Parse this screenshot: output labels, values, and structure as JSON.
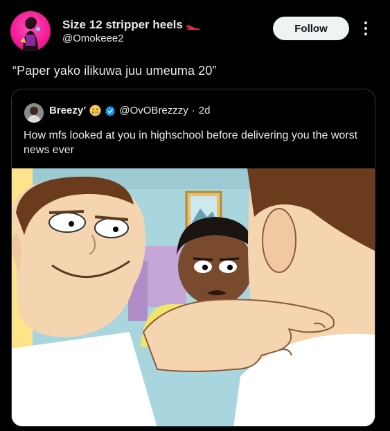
{
  "author": {
    "display_name": "Size 12 stripper heels",
    "name_emoji_icon": "high-heel-icon",
    "handle": "@Omokeee2"
  },
  "follow_button": {
    "label": "Follow"
  },
  "more_menu": {
    "icon": "more-vertical-icon"
  },
  "tweet": {
    "text": "“Paper yako ilikuwa juu umeuma 20”"
  },
  "quoted_tweet": {
    "display_name": "Breezy’",
    "name_emoji_icon": "grimacing-face-icon",
    "verified_icon": "verified-badge-icon",
    "handle": "@OvOBrezzzy",
    "separator": "·",
    "time": "2d",
    "text": "How mfs looked at you in highschool before delivering you the worst news ever",
    "media": {
      "type": "cartoon-image",
      "description_icon": "cartoon-meme-image"
    }
  },
  "colors": {
    "background": "#000000",
    "text": "#e7e9ea",
    "follow_bg": "#eff3f4",
    "border": "#2f3336",
    "verified": "#1d9bf0"
  }
}
